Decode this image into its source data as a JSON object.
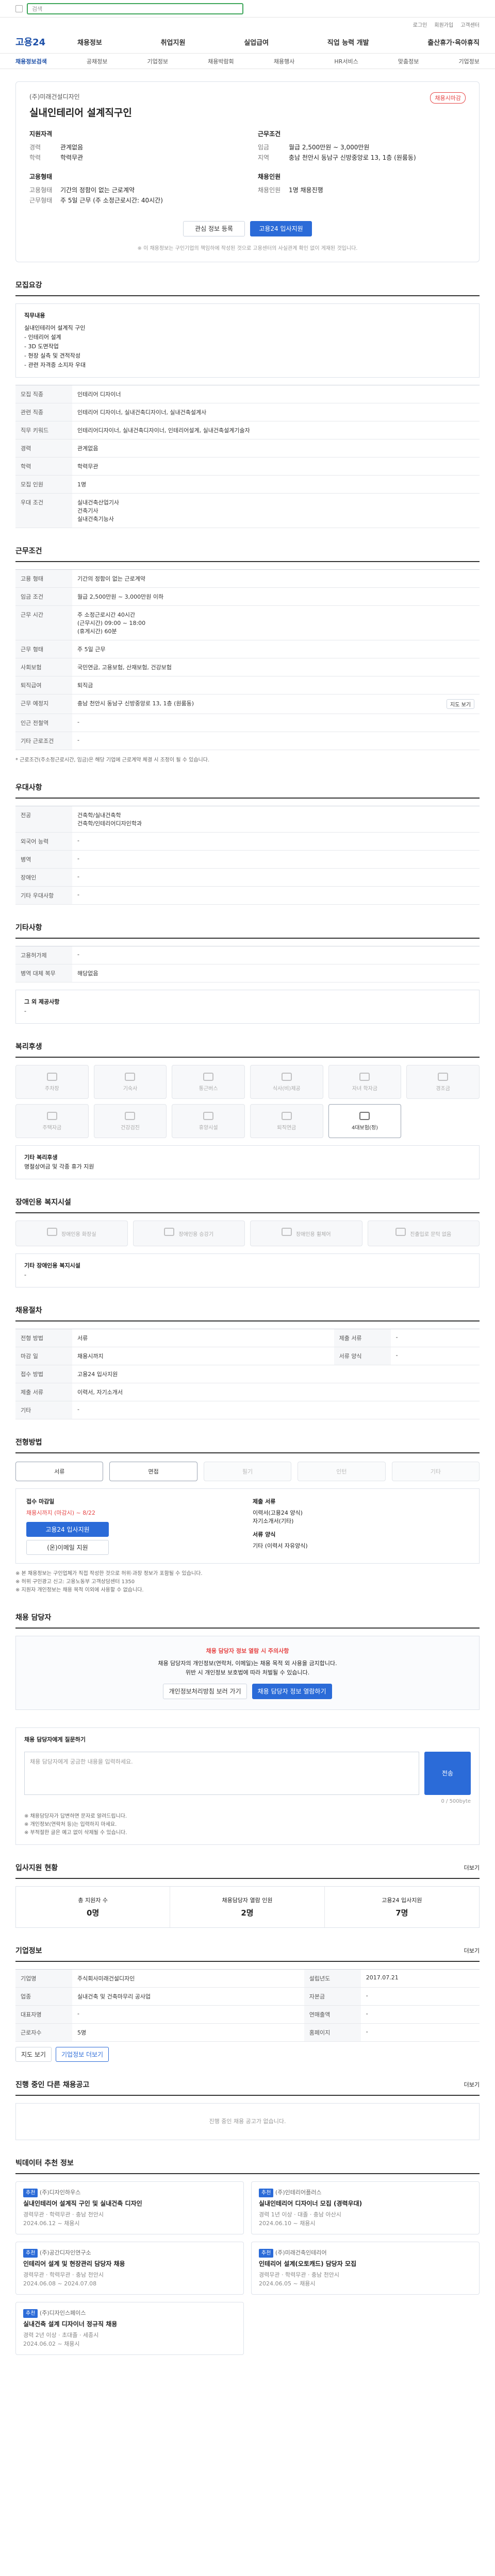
{
  "topbar": {
    "search_placeholder": "검색"
  },
  "util": {
    "items": [
      "로그인",
      "회원가입",
      "고객센터"
    ]
  },
  "gnb": {
    "logo": "고용24",
    "menu": [
      "채용정보",
      "취업지원",
      "실업급여",
      "직업 능력 개발",
      "출산휴가·육아휴직"
    ]
  },
  "subnav": {
    "items": [
      "채용정보검색",
      "공채정보",
      "기업정보",
      "채용박람회",
      "채용행사",
      "HR서비스",
      "맞춤정보",
      "기업정보"
    ],
    "active_index": 0
  },
  "header": {
    "company": "(주)미래건설디자인",
    "title": "실내인테리어 설계직구인",
    "deadline_badge": "채용시마감",
    "left_group_title": "지원자격",
    "left_kv": [
      {
        "k": "경력",
        "v": "관계없음"
      },
      {
        "k": "학력",
        "v": "학력무관"
      }
    ],
    "left_group2_title": "고용형태",
    "left_kv2": [
      {
        "k": "고용형태",
        "v": "기간의 정함이 없는 근로계약"
      },
      {
        "k": "근무형태",
        "v": "주 5일 근무 (주 소정근로시간: 40시간)"
      }
    ],
    "right_group_title": "근무조건",
    "right_kv": [
      {
        "k": "임금",
        "v": "월급 2,500만원 ~ 3,000만원"
      },
      {
        "k": "지역",
        "v": "충남 천안시 동남구 신방중앙로 13, 1층 (원룸동)"
      }
    ],
    "right_group2_title": "채용인원",
    "right_kv2": [
      {
        "k": "채용인원",
        "v": "1명 채용진행"
      }
    ],
    "btn_scrap": "관심 정보 등록",
    "btn_apply": "고용24 입사지원",
    "notice": "※ 이 채용정보는 구인기업의 책임하에 작성된 것으로 고용센터의 사실관계 확인 없이 게재된 것입니다."
  },
  "sec_main": {
    "title": "모집요강",
    "job_title_label": "직무내용",
    "job_desc": "실내인테리어 설계직 구인\n- 인테리어 설계\n- 3D 도면작업\n- 현장 실측 및 견적작성\n- 관련 자격증 소지자 우대",
    "rows": [
      {
        "k": "모집 직종",
        "v": "인테리어 디자이너"
      },
      {
        "k": "관련 직종",
        "v": "인테리어 디자이너, 실내건축디자이너, 실내건축설계사"
      },
      {
        "k": "직무 키워드",
        "v": "인테리어디자이너, 실내건축디자이너, 인테리어설계, 실내건축설계기술자"
      },
      {
        "k": "경력",
        "v": "관계없음"
      },
      {
        "k": "학력",
        "v": "학력무관"
      },
      {
        "k": "모집 인원",
        "v": "1명"
      },
      {
        "k": "우대 조건",
        "v": "실내건축산업기사\n건축기사\n실내건축기능사"
      }
    ]
  },
  "sec_cond": {
    "title": "근무조건",
    "rows": [
      {
        "k": "고용 형태",
        "v": "기간의 정함이 없는 근로계약"
      },
      {
        "k": "임금 조건",
        "v": "월급 2,500만원 ~ 3,000만원 이하"
      },
      {
        "k": "근무 시간",
        "v": "주 소정근로시간 40시간\n(근무시간) 09:00 ~ 18:00\n(휴게시간) 60분"
      },
      {
        "k": "근무 형태",
        "v": "주 5일 근무"
      },
      {
        "k": "사회보험",
        "v": "국민연금, 고용보험, 산재보험, 건강보험"
      },
      {
        "k": "퇴직급여",
        "v": "퇴직금"
      },
      {
        "k": "근무 예정지",
        "v": "충남 천안시 동남구 신방중앙로 13, 1층 (원룸동)"
      },
      {
        "k": "인근 전철역",
        "v": "-"
      },
      {
        "k": "기타 근로조건",
        "v": "-"
      }
    ],
    "map_btn": "지도 보기",
    "footnote": "* 근로조건(주소정근로시간, 임금)은 해당 기업에 근로계약 체결 시 조정이 될 수 있습니다."
  },
  "sec_pref": {
    "title": "우대사항",
    "rows": [
      {
        "k": "전공",
        "v": "건축학/실내건축학\n건축학/인테리어디자인학과"
      },
      {
        "k": "외국어 능력",
        "v": "-"
      },
      {
        "k": "병역",
        "v": "-"
      },
      {
        "k": "장애인",
        "v": "-"
      },
      {
        "k": "기타 우대사항",
        "v": "-"
      }
    ]
  },
  "sec_etc": {
    "title": "기타사항",
    "rows": [
      {
        "k": "고용허가제",
        "v": "-"
      },
      {
        "k": "병역 대체 복무",
        "v": "해당없음"
      }
    ],
    "box_label": "그 외 제공사항",
    "box_text": "-"
  },
  "sec_welfare": {
    "title": "복리후생",
    "items": [
      {
        "label": "주차장",
        "on": false
      },
      {
        "label": "기숙사",
        "on": false
      },
      {
        "label": "통근버스",
        "on": false
      },
      {
        "label": "식사(비)제공",
        "on": false
      },
      {
        "label": "자녀 학자금",
        "on": false
      },
      {
        "label": "경조금",
        "on": false
      },
      {
        "label": "주택자금",
        "on": false
      },
      {
        "label": "건강검진",
        "on": false
      },
      {
        "label": "휴양시설",
        "on": false
      },
      {
        "label": "퇴직연금",
        "on": false
      },
      {
        "label": "4대보험(정)",
        "on": true
      }
    ],
    "box_label": "기타 복리후생",
    "box_text": "명절상여금 및 각종 휴가 지원"
  },
  "sec_disab": {
    "title": "장애인용 복지시설",
    "items": [
      "장애인용 화장실",
      "장애인용 승강기",
      "장애인용 휠체어",
      "진출입로 문턱 없음"
    ],
    "box_label": "기타 장애인용 복지시설",
    "box_text": "-"
  },
  "sec_proc": {
    "title": "채용절차",
    "rows": [
      {
        "k": "전형 방법",
        "v": "서류"
      },
      {
        "k": "마감 일",
        "v": "채용시까지"
      },
      {
        "k": "접수 방법",
        "v": "고용24 입사지원"
      },
      {
        "k": "제출 서류",
        "v": "이력서, 자기소개서"
      },
      {
        "k": "기타",
        "v": "-"
      }
    ],
    "right_rows": [
      {
        "k": "제출 서류",
        "v": "-"
      },
      {
        "k": "서류 양식",
        "v": "-"
      }
    ]
  },
  "sec_apply": {
    "title": "전형방법",
    "steps": [
      {
        "label": "서류",
        "on": true
      },
      {
        "label": "면접",
        "on": true
      },
      {
        "label": "필기",
        "on": false
      },
      {
        "label": "인턴",
        "on": false
      },
      {
        "label": "기타",
        "on": false
      }
    ],
    "recv_title": "접수 마감일",
    "recv_date": "채용시까지 (마감시) ~ 8/22",
    "apply_btn": "고용24 입사지원",
    "email_btn": "(온)이메일 지원",
    "docs_title": "제출 서류",
    "docs_text": "이력서(고용24 양식)\n자기소개서(기타)",
    "format_title": "서류 양식",
    "format_text": "기타 (이력서 자유양식)",
    "notes": [
      "※ 본 채용정보는 구인업체가 직접 작성한 것으로 허위·과장 정보가 포함될 수 있습니다.",
      "※ 허위 구인광고 신고: 고용노동부 고객상담센터 1350",
      "※ 지원자 개인정보는 채용 목적 이외에 사용할 수 없습니다."
    ]
  },
  "sec_manager": {
    "title": "채용 담당자",
    "alert_title": "채용 담당자 정보 열람 시 주의사항",
    "alert_text": "채용 담당자의 개인정보(연락처, 이메일)는 채용 목적 외 사용을 금지합니다.\n위반 시 개인정보 보호법에 따라 처벌될 수 있습니다.",
    "btn_view": "채용 담당자 정보 열람하기",
    "btn_check": "개인정보처리방침 보러 가기"
  },
  "sec_inquiry": {
    "title": "채용 담당자에게 질문하기",
    "placeholder": "채용 담당자에게 궁금한 내용을 입력하세요.",
    "counter": "0 / 500byte",
    "send": "전송",
    "notes": [
      "※ 채용담당자가 답변하면 문자로 알려드립니다.",
      "※ 개인정보(연락처 등)는 입력하지 마세요.",
      "※ 부적절한 글은 예고 없이 삭제될 수 있습니다."
    ]
  },
  "sec_stats": {
    "title": "입사지원 현황",
    "more": "더보기",
    "items": [
      {
        "label": "총 지원자 수",
        "value": "0명"
      },
      {
        "label": "채용담당자 열람 인원",
        "value": "2명"
      },
      {
        "label": "고용24 입사지원",
        "value": "7명"
      }
    ]
  },
  "sec_company": {
    "title": "기업정보",
    "more": "더보기",
    "rows": [
      {
        "k": "기업명",
        "v": "주식회사미래건설디자인"
      },
      {
        "k": "업종",
        "v": "실내건축 및 건축마무리 공사업"
      },
      {
        "k": "대표자명",
        "v": "-"
      },
      {
        "k": "근로자수",
        "v": "5명"
      },
      {
        "k": "설립년도",
        "v": "2017.07.21"
      },
      {
        "k": "자본금",
        "v": "-"
      },
      {
        "k": "연매출액",
        "v": "-"
      },
      {
        "k": "홈페이지",
        "v": "-"
      }
    ],
    "btn_map": "지도 보기",
    "btn_more": "기업정보 더보기"
  },
  "sec_other": {
    "title": "진행 중인 다른 채용공고",
    "more": "더보기",
    "empty": "진행 중인 채용 공고가 없습니다."
  },
  "sec_reco": {
    "title": "빅데이터 추천 정보",
    "cards": [
      {
        "badge": "추천",
        "company": "(주)디자인하우스",
        "title": "실내인테리어 설계직 구인 및 실내건축 디자인",
        "meta": "경력무관 · 학력무관 · 충남 천안시",
        "date": "2024.06.12 ~ 채용시"
      },
      {
        "badge": "추천",
        "company": "(주)인테리어플러스",
        "title": "실내인테리어 디자이너 모집 (경력우대)",
        "meta": "경력 1년 이상 · 대졸 · 충남 아산시",
        "date": "2024.06.10 ~ 채용시"
      },
      {
        "badge": "추천",
        "company": "(주)공간디자인연구소",
        "title": "인테리어 설계 및 현장관리 담당자 채용",
        "meta": "경력무관 · 학력무관 · 충남 천안시",
        "date": "2024.06.08 ~ 2024.07.08"
      },
      {
        "badge": "추천",
        "company": "(주)미래건축인테리어",
        "title": "인테리어 설계(오토캐드) 담당자 모집",
        "meta": "경력무관 · 학력무관 · 충남 천안시",
        "date": "2024.06.05 ~ 채용시"
      },
      {
        "badge": "추천",
        "company": "(주)디자인스페이스",
        "title": "실내건축 설계 디자이너 정규직 채용",
        "meta": "경력 2년 이상 · 초대졸 · 세종시",
        "date": "2024.06.02 ~ 채용시"
      }
    ]
  }
}
